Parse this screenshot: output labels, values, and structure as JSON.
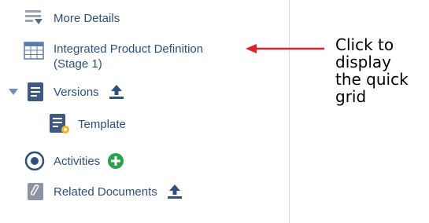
{
  "tree": {
    "more_details": {
      "label": "More Details",
      "icon": "details-list-icon"
    },
    "ipd": {
      "label_line1": "Integrated Product Definition",
      "label_line2": "(Stage 1)",
      "icon": "grid-table-icon"
    },
    "versions": {
      "label": "Versions",
      "icon": "document-icon",
      "expanded": true
    },
    "template": {
      "label": "Template",
      "icon": "template-document-icon"
    },
    "activities": {
      "label": "Activities",
      "icon": "radio-target-icon"
    },
    "related_documents": {
      "label": "Related Documents",
      "icon": "paperclip-icon"
    }
  },
  "annotation": {
    "lines": [
      "Click to",
      "display",
      "the quick",
      "grid"
    ],
    "arrow_color": "#e0202a"
  },
  "colors": {
    "link": "#2e4f7f",
    "icon_gray": "#8a94a3",
    "icon_blue": "#3d5a80",
    "add_green": "#2aa14a",
    "upload_blue": "#2e4f7f"
  }
}
